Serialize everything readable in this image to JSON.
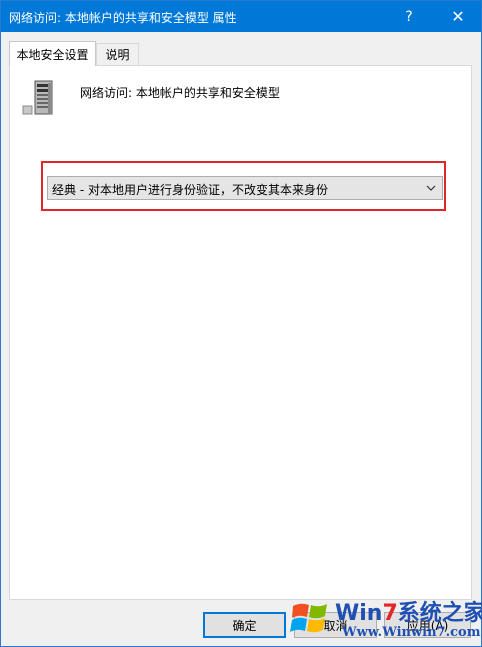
{
  "window": {
    "title": "网络访问: 本地帐户的共享和安全模型 属性",
    "help_glyph": "?",
    "close_glyph": "✕"
  },
  "tabs": [
    {
      "label": "本地安全设置",
      "active": true
    },
    {
      "label": "说明",
      "active": false
    }
  ],
  "policy": {
    "icon": "server-icon",
    "title": "网络访问: 本地帐户的共享和安全模型"
  },
  "dropdown": {
    "selected": "经典 - 对本地用户进行身份验证，不改变其本来身份",
    "highlight_color": "#e0262b"
  },
  "buttons": {
    "ok": "确定",
    "cancel": "取消",
    "apply": "应用(A)"
  },
  "watermark": {
    "brand_prefix": "Win",
    "brand_seven": "7",
    "brand_suffix": "系统之家",
    "url": "Www.Winwin7.com"
  },
  "colors": {
    "titlebar": "#0078d7",
    "accent": "#0078d7"
  }
}
